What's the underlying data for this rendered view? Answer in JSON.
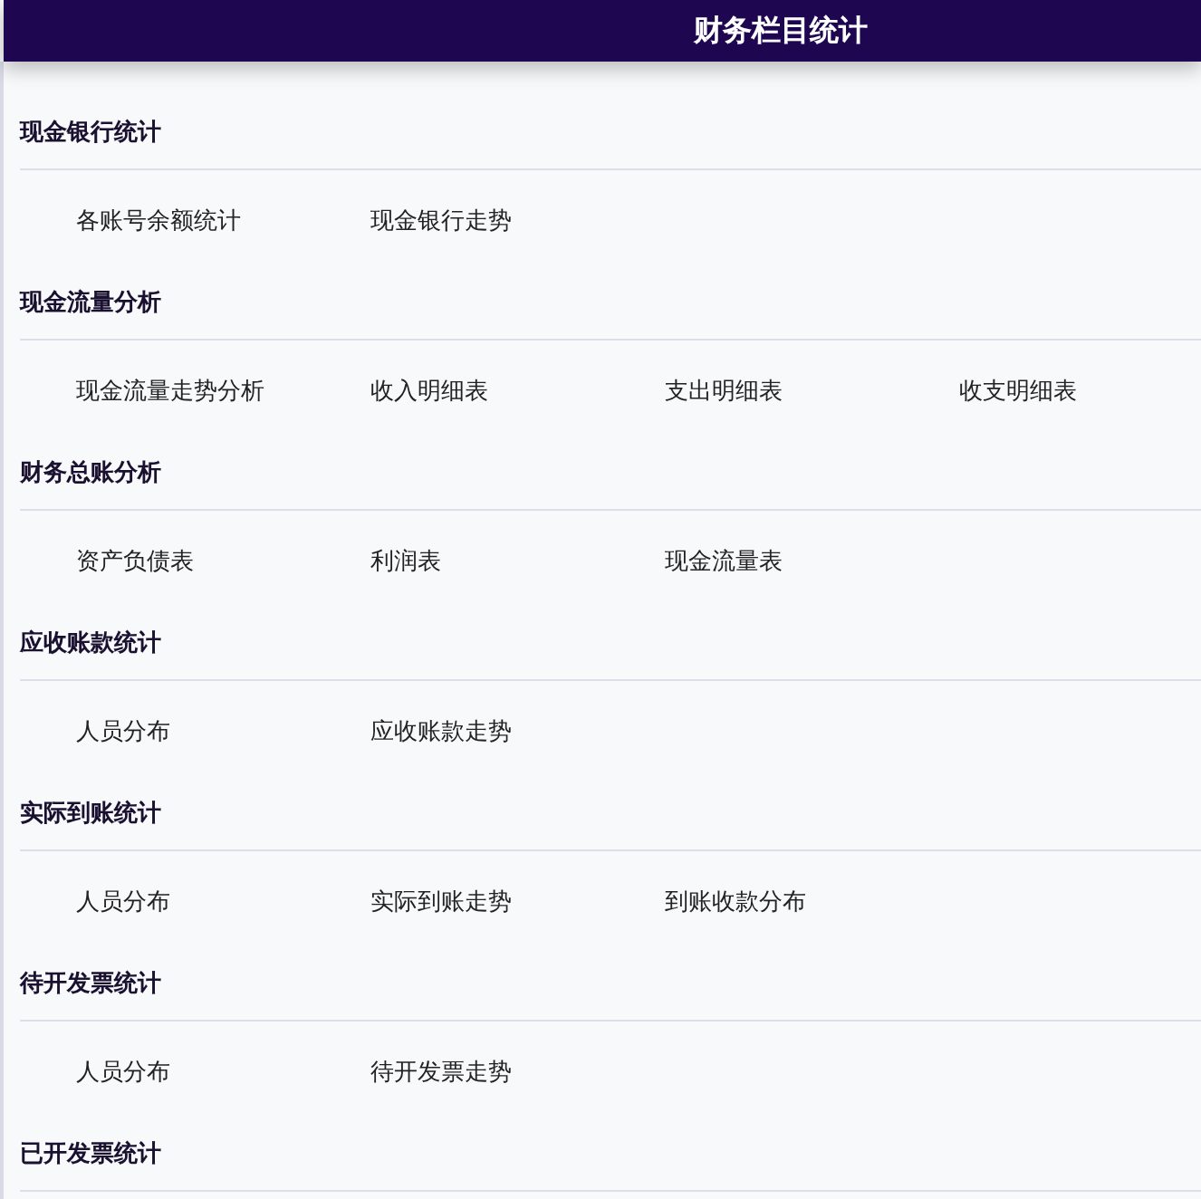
{
  "header": {
    "title": "财务栏目统计"
  },
  "sections": [
    {
      "title": "现金银行统计",
      "items": [
        "各账号余额统计",
        "现金银行走势"
      ]
    },
    {
      "title": "现金流量分析",
      "items": [
        "现金流量走势分析",
        "收入明细表",
        "支出明细表",
        "收支明细表"
      ]
    },
    {
      "title": "财务总账分析",
      "items": [
        "资产负债表",
        "利润表",
        "现金流量表"
      ]
    },
    {
      "title": "应收账款统计",
      "items": [
        "人员分布",
        "应收账款走势"
      ]
    },
    {
      "title": "实际到账统计",
      "items": [
        "人员分布",
        "实际到账走势",
        "到账收款分布"
      ]
    },
    {
      "title": "待开发票统计",
      "items": [
        "人员分布",
        "待开发票走势"
      ]
    },
    {
      "title": "已开发票统计"
    }
  ]
}
